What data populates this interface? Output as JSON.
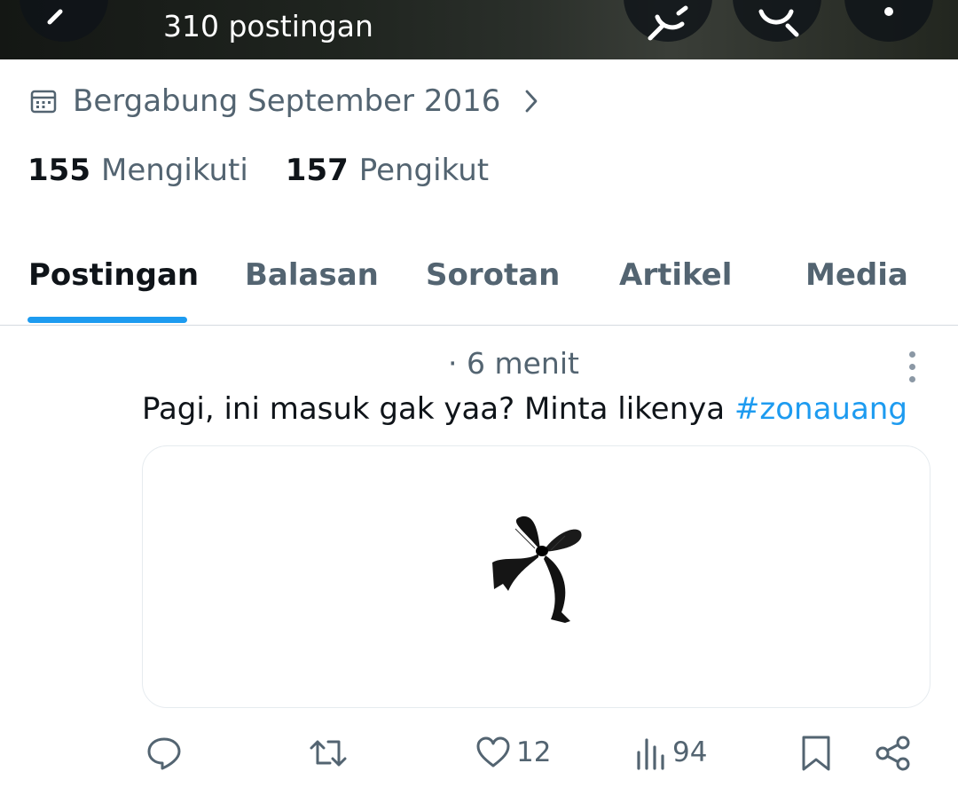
{
  "header": {
    "post_count": "310 postingan",
    "back_icon": "arrow-left-icon",
    "grok_icon": "grok-icon",
    "search_icon": "search-icon",
    "more_icon": "more-vertical-icon"
  },
  "profile": {
    "joined": "Bergabung September 2016",
    "following_count": "155",
    "following_label": "Mengikuti",
    "followers_count": "157",
    "followers_label": "Pengikut"
  },
  "tabs": [
    {
      "label": "Postingan",
      "active": true
    },
    {
      "label": "Balasan",
      "active": false
    },
    {
      "label": "Sorotan",
      "active": false
    },
    {
      "label": "Artikel",
      "active": false
    },
    {
      "label": "Media",
      "active": false
    }
  ],
  "post": {
    "time": "· 6 menit",
    "text": "Pagi, ini masuk gak yaa? Minta likenya ",
    "hashtag": "#zonauang",
    "image": "black-ribbon-bow",
    "likes": "12",
    "views": "94"
  },
  "colors": {
    "accent": "#1d9bf0",
    "text_primary": "#0f1419",
    "text_secondary": "#536471"
  }
}
